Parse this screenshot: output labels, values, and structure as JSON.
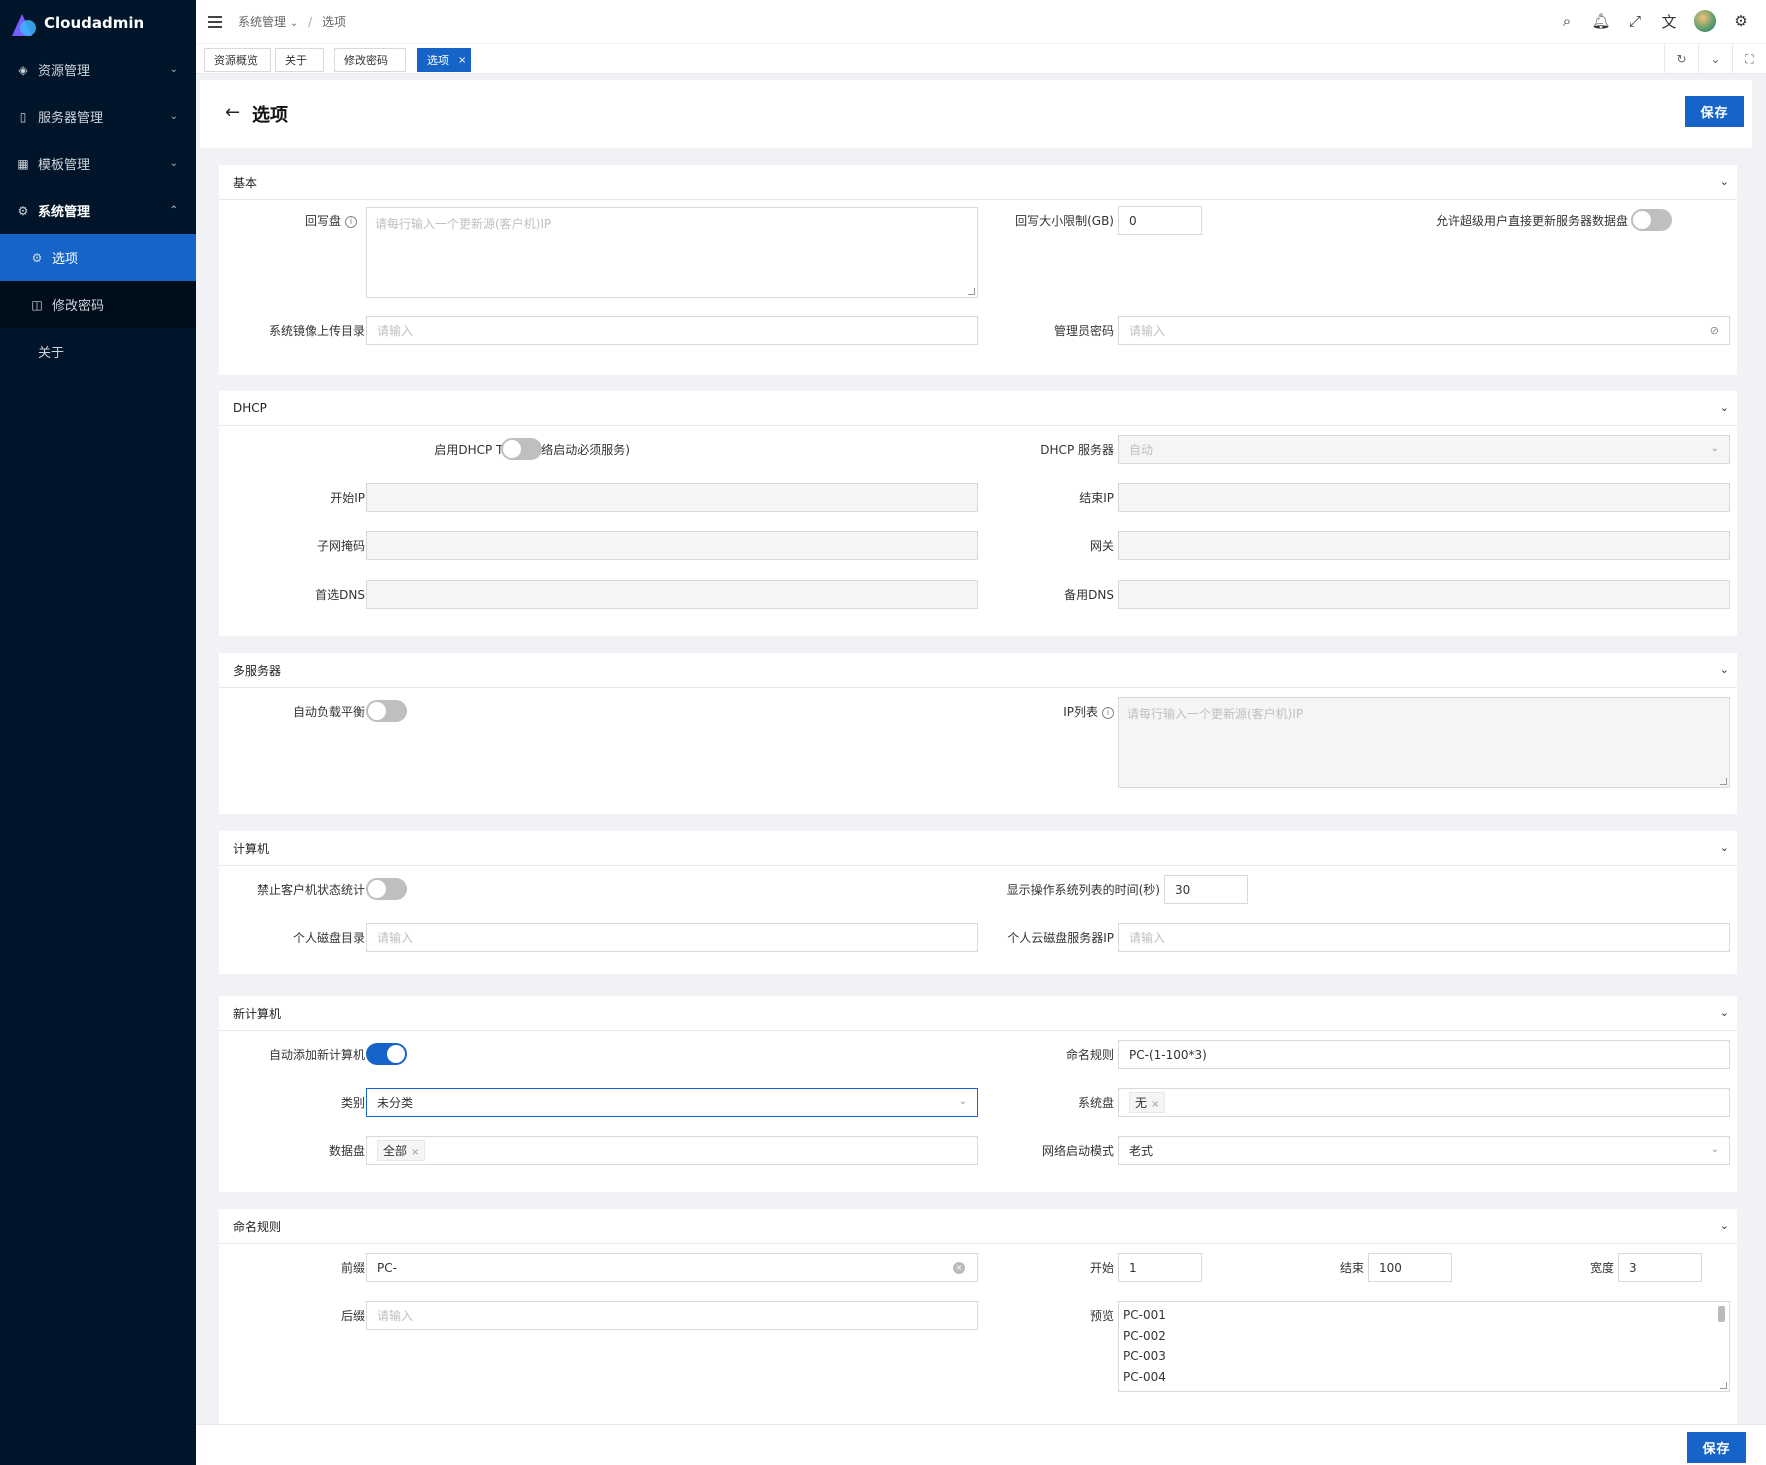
{
  "app": {
    "name": "Cloudadmin"
  },
  "sidebar": {
    "items": [
      {
        "label": "资源管理",
        "icon": "resource-icon"
      },
      {
        "label": "服务器管理",
        "icon": "server-icon"
      },
      {
        "label": "模板管理",
        "icon": "template-icon"
      },
      {
        "label": "系统管理",
        "icon": "gear-icon"
      }
    ],
    "sub_items": [
      {
        "label": "选项",
        "icon": "gear-icon"
      },
      {
        "label": "修改密码",
        "icon": "lock-icon"
      },
      {
        "label": "关于",
        "icon": ""
      }
    ]
  },
  "breadcrumb": {
    "parent": "系统管理",
    "current": "选项"
  },
  "tabs": [
    {
      "label": "资源概览"
    },
    {
      "label": "关于"
    },
    {
      "label": "修改密码"
    },
    {
      "label": "选项",
      "close": "×"
    }
  ],
  "page": {
    "title": "选项",
    "save_label": "保存"
  },
  "sections": {
    "basic": {
      "title": "基本",
      "writeback_label": "回写盘",
      "writeback_placeholder": "请每行输入一个更新源(客户机)IP",
      "writeback_limit_label": "回写大小限制(GB)",
      "writeback_limit_value": "0",
      "allow_superuser_label": "允许超级用户直接更新服务器数据盘",
      "image_dir_label": "系统镜像上传目录",
      "image_dir_placeholder": "请输入",
      "admin_pwd_label": "管理员密码",
      "admin_pwd_placeholder": "请输入"
    },
    "dhcp": {
      "title": "DHCP",
      "enable_label": "启用DHCP TFTP(网络启动必须服务)",
      "server_label": "DHCP 服务器",
      "server_value": "自动",
      "start_ip_label": "开始IP",
      "end_ip_label": "结束IP",
      "mask_label": "子网掩码",
      "gateway_label": "网关",
      "dns1_label": "首选DNS",
      "dns2_label": "备用DNS"
    },
    "multi": {
      "title": "多服务器",
      "balance_label": "自动负载平衡",
      "ip_list_label": "IP列表",
      "ip_list_placeholder": "请每行输入一个更新源(客户机)IP"
    },
    "computer": {
      "title": "计算机",
      "disable_stat_label": "禁止客户机状态统计",
      "os_list_time_label": "显示操作系统列表的时间(秒)",
      "os_list_time_value": "30",
      "personal_disk_label": "个人磁盘目录",
      "personal_disk_placeholder": "请输入",
      "cloud_disk_ip_label": "个人云磁盘服务器IP",
      "cloud_disk_ip_placeholder": "请输入"
    },
    "new_computer": {
      "title": "新计算机",
      "auto_add_label": "自动添加新计算机",
      "naming_rule_label": "命名规则",
      "naming_rule_value": "PC-(1-100*3)",
      "category_label": "类别",
      "category_value": "未分类",
      "system_disk_label": "系统盘",
      "system_disk_tag": "无",
      "data_disk_label": "数据盘",
      "data_disk_tag": "全部",
      "boot_mode_label": "网络启动模式",
      "boot_mode_value": "老式"
    },
    "naming": {
      "title": "命名规则",
      "prefix_label": "前缀",
      "prefix_value": "PC-",
      "start_label": "开始",
      "start_value": "1",
      "end_label": "结束",
      "end_value": "100",
      "width_label": "宽度",
      "width_value": "3",
      "suffix_label": "后缀",
      "suffix_placeholder": "请输入",
      "preview_label": "预览",
      "preview": [
        "PC-001",
        "PC-002",
        "PC-003",
        "PC-004"
      ]
    }
  },
  "toggles": {
    "allow_superuser": false,
    "dhcp_enable": false,
    "auto_balance": false,
    "disable_stat": false,
    "auto_add": true
  },
  "colors": {
    "sidebar_bg": "#001529",
    "primary": "#1764c9"
  }
}
